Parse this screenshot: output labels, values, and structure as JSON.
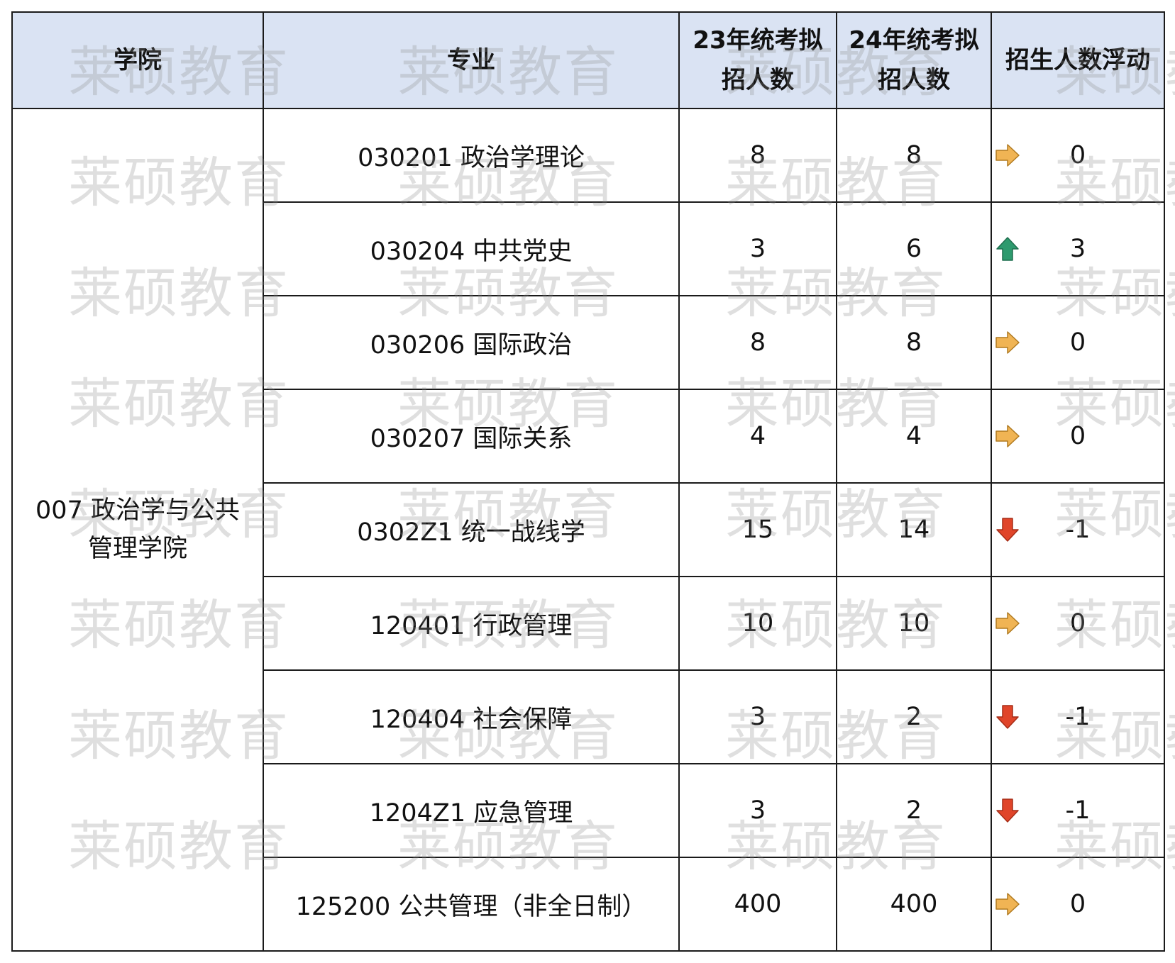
{
  "header": {
    "college": "学院",
    "major": "专业",
    "quota_23_line1": "23年统考拟",
    "quota_23_line2": "招人数",
    "quota_24_line1": "24年统考拟",
    "quota_24_line2": "招人数",
    "change": "招生人数浮动"
  },
  "college": {
    "line1": "007 政治学与公共",
    "line2": "管理学院"
  },
  "rows": [
    {
      "major": "030201 政治学理论",
      "q23": "8",
      "q24": "8",
      "trend": "flat",
      "change": "0"
    },
    {
      "major": "030204 中共党史",
      "q23": "3",
      "q24": "6",
      "trend": "up",
      "change": "3"
    },
    {
      "major": "030206 国际政治",
      "q23": "8",
      "q24": "8",
      "trend": "flat",
      "change": "0"
    },
    {
      "major": "030207 国际关系",
      "q23": "4",
      "q24": "4",
      "trend": "flat",
      "change": "0"
    },
    {
      "major": "0302Z1 统一战线学",
      "q23": "15",
      "q24": "14",
      "trend": "down",
      "change": "-1"
    },
    {
      "major": "120401 行政管理",
      "q23": "10",
      "q24": "10",
      "trend": "flat",
      "change": "0"
    },
    {
      "major": "120404 社会保障",
      "q23": "3",
      "q24": "2",
      "trend": "down",
      "change": "-1"
    },
    {
      "major": "1204Z1 应急管理",
      "q23": "3",
      "q24": "2",
      "trend": "down",
      "change": "-1"
    },
    {
      "major": "125200 公共管理（非全日制）",
      "q23": "400",
      "q24": "400",
      "trend": "flat",
      "change": "0"
    }
  ],
  "icons": {
    "flat": {
      "name": "arrow-right-icon",
      "color": "#f0b454"
    },
    "up": {
      "name": "arrow-up-icon",
      "color": "#2e9a6e"
    },
    "down": {
      "name": "arrow-down-icon",
      "color": "#e0452a"
    }
  },
  "watermark": "莱硕教育",
  "colors": {
    "header_bg": "#dae3f3",
    "border": "#1a1a1a"
  }
}
